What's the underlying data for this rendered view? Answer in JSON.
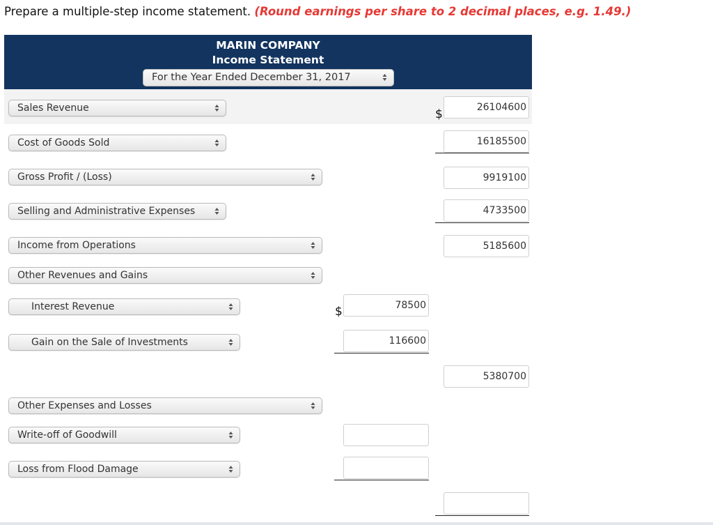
{
  "instruction": {
    "text": "Prepare a multiple-step income statement.",
    "hint": "(Round earnings per share to 2 decimal places, e.g. 1.49.)",
    "hint_color": "#e53935"
  },
  "header": {
    "company": "MARIN COMPANY",
    "statement": "Income Statement",
    "period_select": "For the Year Ended December 31, 2017",
    "bg_color": "#12345f"
  },
  "currency_symbol": "$",
  "rows": [
    {
      "label": "Sales Revenue",
      "col1": null,
      "col2": "26104600"
    },
    {
      "label": "Cost of Goods Sold",
      "col1": null,
      "col2": "16185500"
    },
    {
      "label": "Gross Profit / (Loss)",
      "col1": null,
      "col2": "9919100"
    },
    {
      "label": "Selling and Administrative Expenses",
      "col1": null,
      "col2": "4733500"
    },
    {
      "label": "Income from Operations",
      "col1": null,
      "col2": "5185600"
    },
    {
      "label": "Other Revenues and Gains",
      "col1": null,
      "col2": null
    },
    {
      "label": "Interest Revenue",
      "col1": "78500",
      "col2": null
    },
    {
      "label": "Gain on the Sale of Investments",
      "col1": "116600",
      "col2": null
    },
    {
      "label": null,
      "col1": null,
      "col2": "5380700"
    },
    {
      "label": "Other Expenses and Losses",
      "col1": null,
      "col2": null
    },
    {
      "label": "Write-off of Goodwill",
      "col1": "",
      "col2": null
    },
    {
      "label": "Loss from Flood Damage",
      "col1": "",
      "col2": null
    },
    {
      "label": null,
      "col1": null,
      "col2": ""
    }
  ]
}
